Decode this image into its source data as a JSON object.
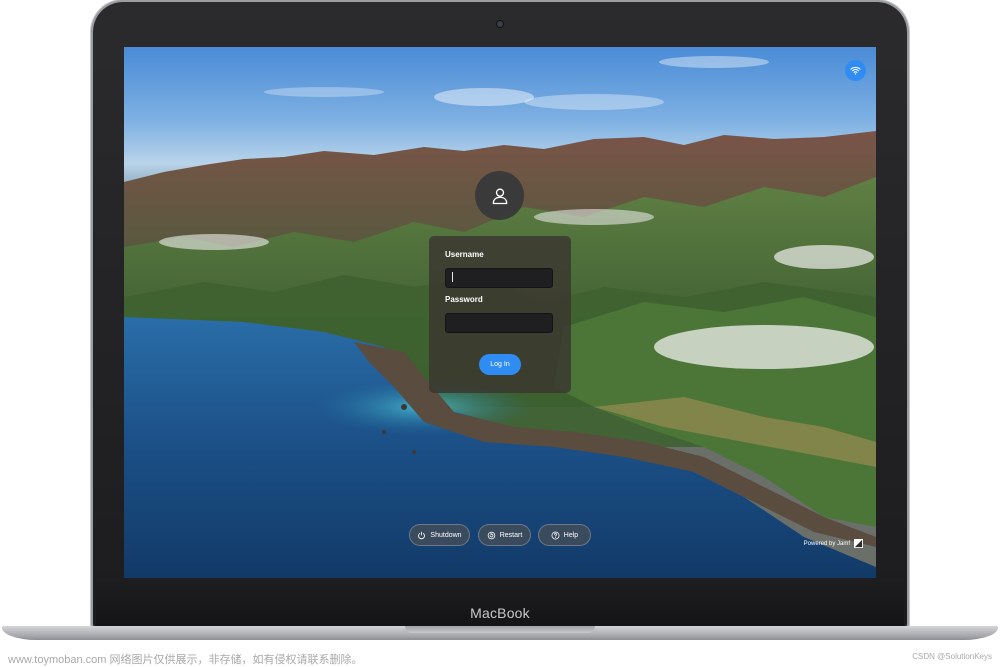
{
  "device": {
    "brand_label": "MacBook"
  },
  "login": {
    "username_label": "Username",
    "username_value": "",
    "password_label": "Password",
    "password_value": "",
    "login_button": "Log In"
  },
  "power_buttons": {
    "shutdown": "Shutdown",
    "restart": "Restart",
    "help": "Help"
  },
  "footer": {
    "powered_by": "Powered by Jamf"
  },
  "watermark": {
    "left": "www.toymoban.com 网络图片仅供展示，非存储，如有侵权请联系删除。",
    "right": "CSDN @SolutionKeys"
  },
  "icons": {
    "wifi": "wifi-icon",
    "user": "user-icon",
    "power": "power-icon",
    "restart": "restart-icon",
    "help": "help-icon",
    "jamf": "jamf-logo-icon"
  },
  "colors": {
    "accent": "#2f8cf2",
    "panel": "#3a3630",
    "input": "#1f1f21"
  }
}
